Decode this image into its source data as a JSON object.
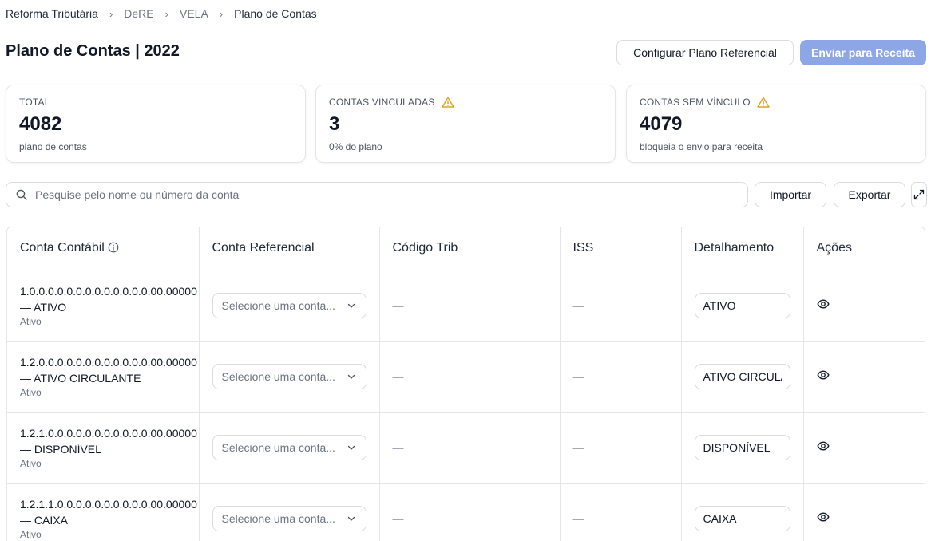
{
  "breadcrumb": {
    "items": [
      "Reforma Tributária",
      "DeRE",
      "VELA",
      "Plano de Contas"
    ],
    "separator": "›"
  },
  "page": {
    "title": "Plano de Contas | 2022"
  },
  "actions": {
    "configure_label": "Configurar Plano Referencial",
    "send_label": "Enviar para Receita"
  },
  "cards": [
    {
      "label": "TOTAL",
      "value": "4082",
      "sub": "plano de contas",
      "warning": false
    },
    {
      "label": "CONTAS VINCULADAS",
      "value": "3",
      "sub": "0% do plano",
      "warning": true
    },
    {
      "label": "CONTAS SEM VÍNCULO",
      "value": "4079",
      "sub": "bloqueia o envio para receita",
      "warning": true
    }
  ],
  "search": {
    "placeholder": "Pesquise pelo nome ou número da conta",
    "value": ""
  },
  "toolbar": {
    "import_label": "Importar",
    "export_label": "Exportar"
  },
  "table": {
    "headers": [
      "Conta Contábil",
      "Conta Referencial",
      "Código Trib",
      "ISS",
      "Detalhamento",
      "Ações"
    ],
    "select_placeholder": "Selecione uma conta...",
    "empty": "—",
    "rows": [
      {
        "code": "1.0.0.0.0.0.0.0.0.0.0.0.0.0.00.00000",
        "name": "— ATIVO",
        "type": "Ativo",
        "detail": "ATIVO"
      },
      {
        "code": "1.2.0.0.0.0.0.0.0.0.0.0.0.0.00.00000",
        "name": "— ATIVO CIRCULANTE",
        "type": "Ativo",
        "detail": "ATIVO CIRCULANTE"
      },
      {
        "code": "1.2.1.0.0.0.0.0.0.0.0.0.0.0.00.00000",
        "name": "— DISPONÍVEL",
        "type": "Ativo",
        "detail": "DISPONÍVEL"
      },
      {
        "code": "1.2.1.1.0.0.0.0.0.0.0.0.0.0.00.00000",
        "name": "— CAIXA",
        "type": "Ativo",
        "detail": "CAIXA"
      }
    ]
  },
  "colors": {
    "primary_button": "#8da6e6",
    "warning": "#e0a126",
    "border": "#e4e6ea"
  }
}
